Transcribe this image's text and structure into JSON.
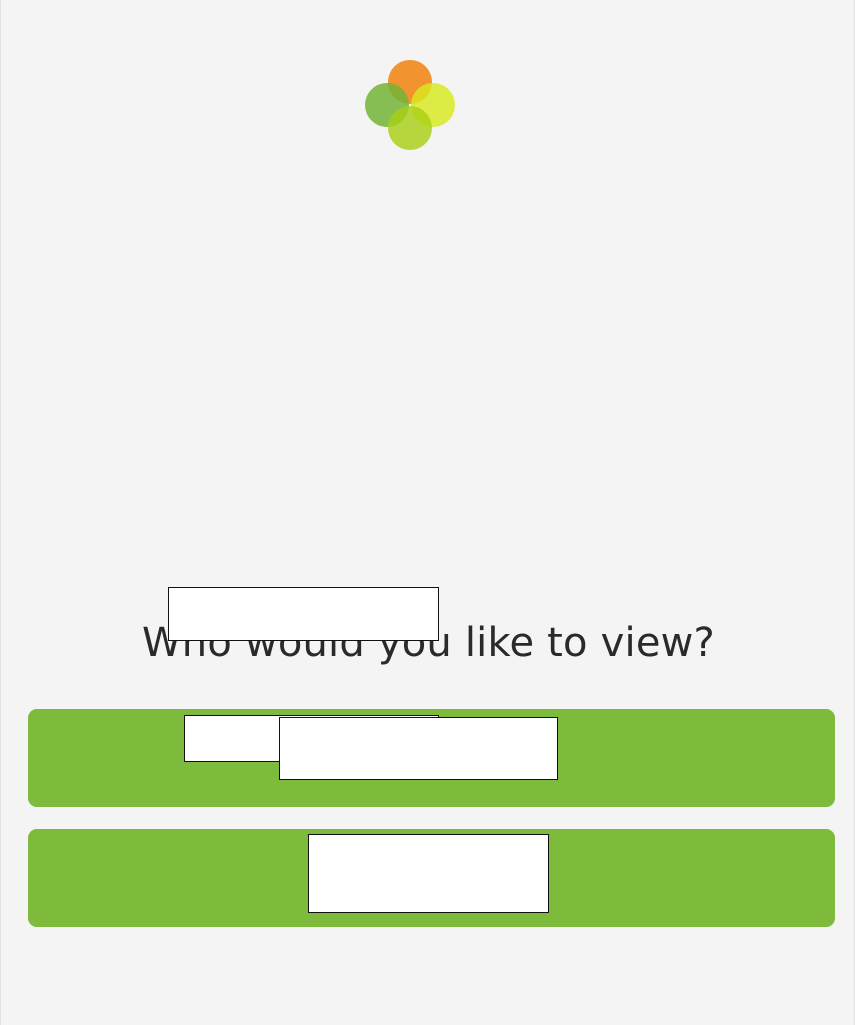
{
  "app": {
    "logo_icon": "four-circle-clover-logo-icon",
    "logo_colors": {
      "top": "#f08a1c",
      "left": "#72b436",
      "right": "#d8ea1e",
      "bottom": "#a9cf16"
    }
  },
  "main": {
    "prompt": "Who would you like to view?"
  },
  "options": [
    {
      "label": ""
    },
    {
      "label": ""
    }
  ],
  "colors": {
    "background": "#f4f4f4",
    "accent": "#7ebb3d",
    "text": "#2a2a2a"
  }
}
